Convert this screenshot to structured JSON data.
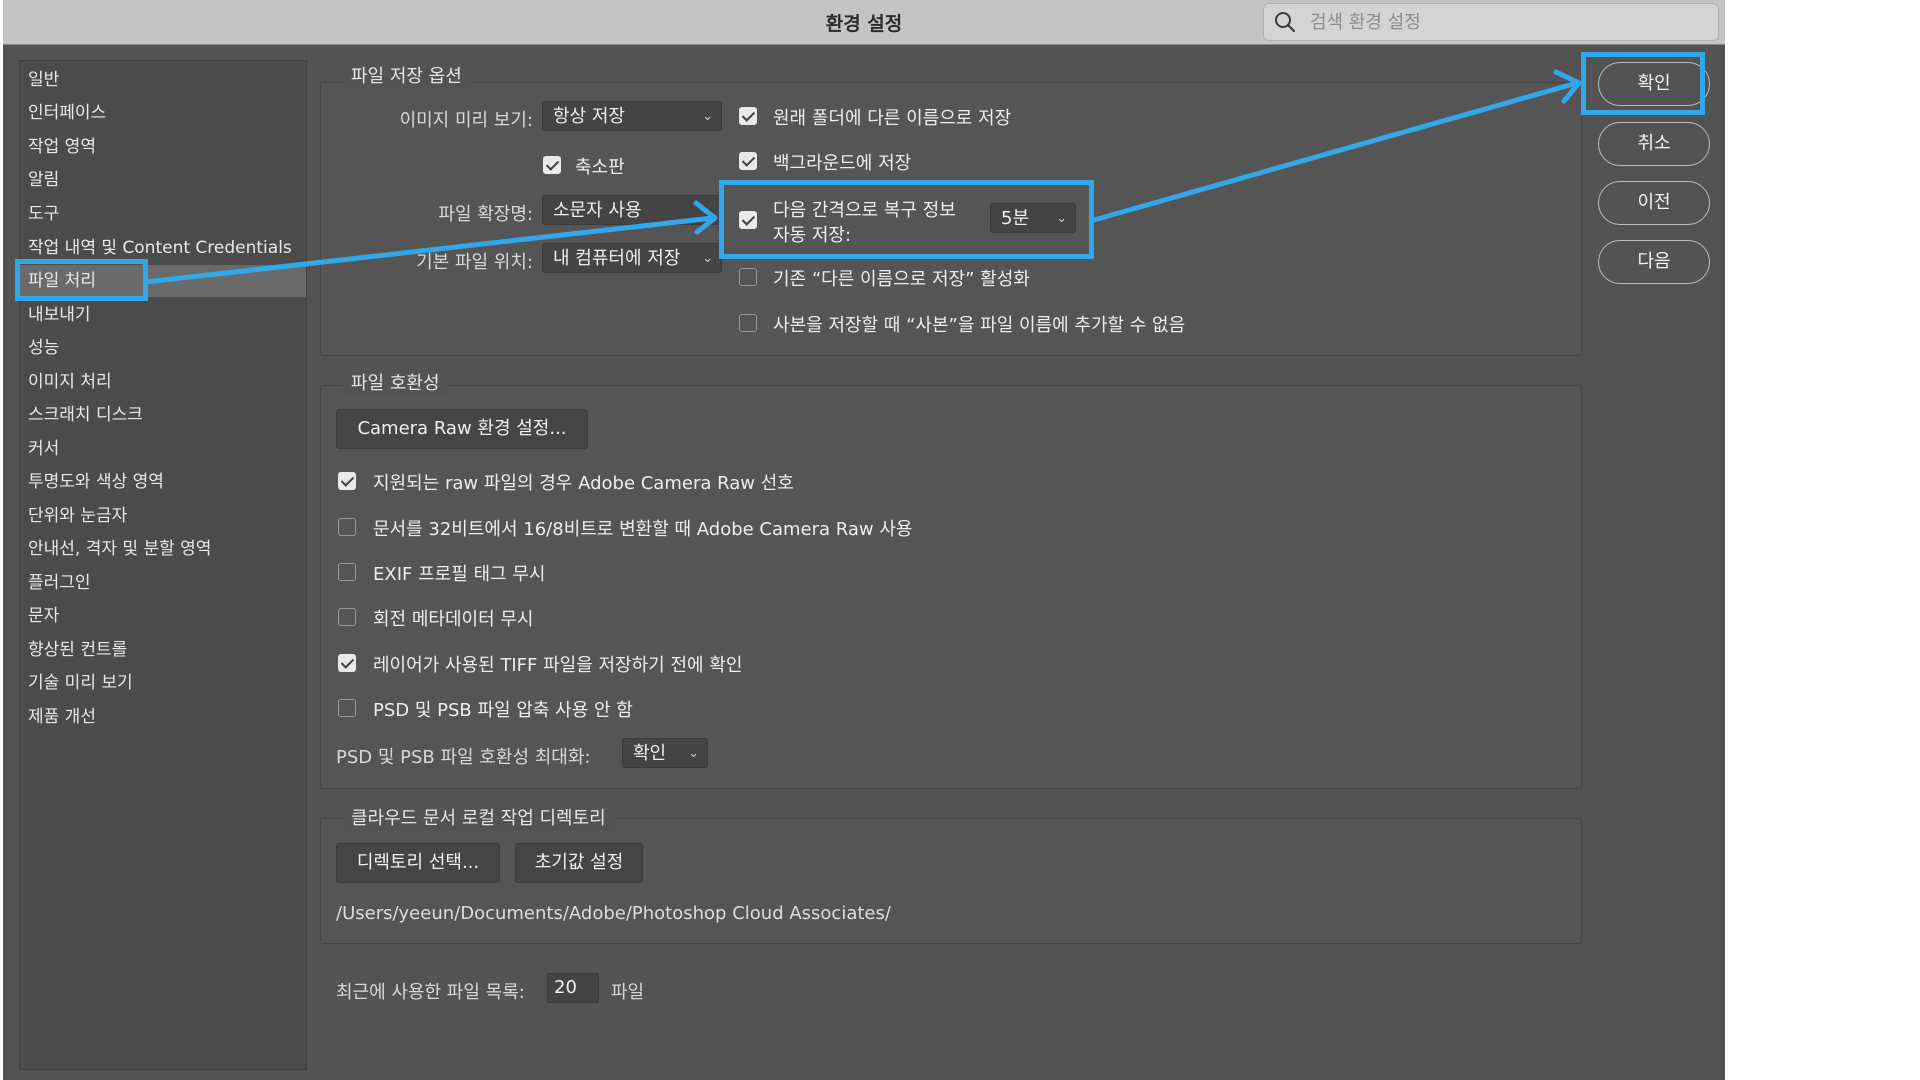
{
  "window": {
    "title": "환경 설정",
    "search_placeholder": "검색 환경 설정"
  },
  "sidebar": {
    "items": [
      {
        "label": "일반"
      },
      {
        "label": "인터페이스"
      },
      {
        "label": "작업 영역"
      },
      {
        "label": "알림"
      },
      {
        "label": "도구"
      },
      {
        "label": "작업 내역 및 Content Credentials"
      },
      {
        "label": "파일 처리",
        "selected": true
      },
      {
        "label": "내보내기"
      },
      {
        "label": "성능"
      },
      {
        "label": "이미지 처리"
      },
      {
        "label": "스크래치 디스크"
      },
      {
        "label": "커서"
      },
      {
        "label": "투명도와 색상 영역"
      },
      {
        "label": "단위와 눈금자"
      },
      {
        "label": "안내선, 격자 및 분할 영역"
      },
      {
        "label": "플러그인"
      },
      {
        "label": "문자"
      },
      {
        "label": "향상된 컨트롤"
      },
      {
        "label": "기술 미리 보기"
      },
      {
        "label": "제품 개선"
      }
    ]
  },
  "file_save": {
    "legend": "파일 저장 옵션",
    "image_preview_label": "이미지 미리 보기:",
    "image_preview_value": "항상 저장",
    "thumbnail_label": "축소판",
    "thumbnail_checked": true,
    "extension_label": "파일 확장명:",
    "extension_value": "소문자 사용",
    "default_location_label": "기본 파일 위치:",
    "default_location_value": "내 컴퓨터에 저장",
    "save_as_original_folder": {
      "label": "원래 폴더에 다른 이름으로 저장",
      "checked": true
    },
    "save_in_background": {
      "label": "백그라운드에 저장",
      "checked": true
    },
    "auto_save": {
      "label_line1": "다음 간격으로 복구 정보",
      "label_line2": "자동 저장:",
      "checked": true,
      "interval": "5분"
    },
    "legacy_save_as": {
      "label": "기존 “다른 이름으로 저장” 활성화",
      "checked": false
    },
    "no_copy_suffix": {
      "label": "사본을 저장할 때 “사본”을 파일 이름에 추가할 수 없음",
      "checked": false
    }
  },
  "file_compat": {
    "legend": "파일 호환성",
    "camera_raw_button": "Camera Raw 환경 설정...",
    "options": [
      {
        "label": "지원되는 raw 파일의 경우 Adobe Camera Raw 선호",
        "checked": true
      },
      {
        "label": "문서를 32비트에서 16/8비트로 변환할 때 Adobe Camera Raw 사용",
        "checked": false
      },
      {
        "label": "EXIF 프로필 태그 무시",
        "checked": false
      },
      {
        "label": "회전 메타데이터 무시",
        "checked": false
      },
      {
        "label": "레이어가 사용된 TIFF 파일을 저장하기 전에 확인",
        "checked": true
      },
      {
        "label": "PSD 및 PSB 파일 압축 사용 안 함",
        "checked": false
      }
    ],
    "maximize_label": "PSD 및 PSB 파일 호환성 최대화:",
    "maximize_value": "확인"
  },
  "cloud_dir": {
    "legend": "클라우드 문서 로컬 작업 디렉토리",
    "choose_button": "디렉토리 선택...",
    "reset_button": "초기값 설정",
    "path": "/Users/yeeun/Documents/Adobe/Photoshop Cloud Associates/"
  },
  "recent_files": {
    "label": "최근에 사용한 파일 목록:",
    "value": "20",
    "unit": "파일"
  },
  "actions": {
    "ok": "확인",
    "cancel": "취소",
    "prev": "이전",
    "next": "다음"
  },
  "colors": {
    "highlight": "#32a8ea",
    "dialog_bg": "#535353",
    "titlebar_bg": "#c4c4c4"
  }
}
